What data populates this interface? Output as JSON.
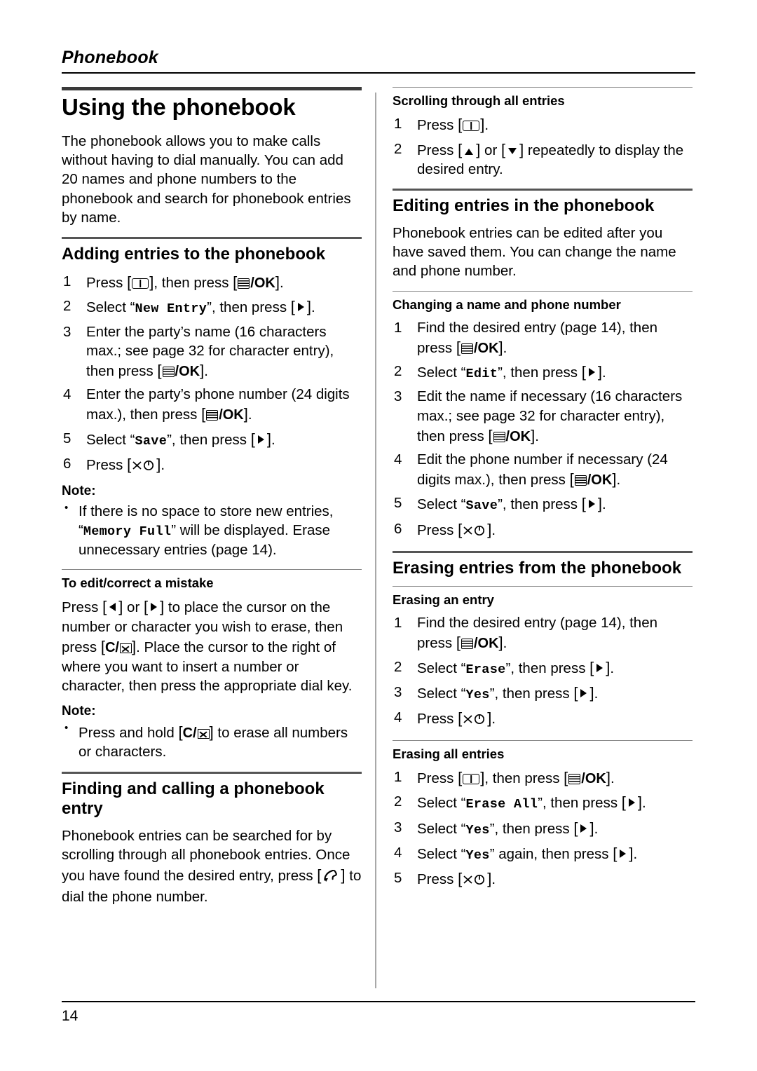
{
  "header": {
    "running_title": "Phonebook"
  },
  "footer": {
    "page_number": "14"
  },
  "left_column": {
    "section_title": "Using the phonebook",
    "intro": "The phonebook allows you to make calls without having to dial manually. You can add 20 names and phone numbers to the phonebook and search for phonebook entries by name.",
    "adding": {
      "title": "Adding entries to the phonebook",
      "steps": [
        "Press [□], then press [≡/OK].",
        "Select “New Entry”, then press [▶].",
        "Enter the party’s name (16 characters max.; see page 32 for character entry), then press [≡/OK].",
        "Enter the party’s phone number (24 digits max.), then press [≡/OK].",
        "Select “Save”, then press [▶].",
        "Press [off]."
      ],
      "note_label": "Note:",
      "note": "If there is no space to store new entries, “Memory Full” will be displayed. Erase unnecessary entries (page 14)."
    },
    "edit_correct": {
      "title": "To edit/correct a mistake",
      "body": "Press [◀] or [▶] to place the cursor on the number or character you wish to erase, then press [C/⌧]. Place the cursor to the right of where you want to insert a number or character, then press the appropriate dial key.",
      "note_label": "Note:",
      "note": "Press and hold [C/⌧] to erase all numbers or characters."
    },
    "finding": {
      "title": "Finding and calling a phonebook entry",
      "body": "Phonebook entries can be searched for by scrolling through all phonebook entries. Once you have found the desired entry, press [talk] to dial the phone number."
    }
  },
  "right_column": {
    "scrolling": {
      "title": "Scrolling through all entries",
      "steps": [
        "Press [□].",
        "Press [▲] or [▼] repeatedly to display the desired entry."
      ]
    },
    "editing": {
      "title": "Editing entries in the phonebook",
      "body": "Phonebook entries can be edited after you have saved them. You can change the name and phone number."
    },
    "changing": {
      "title": "Changing a name and phone number",
      "steps": [
        "Find the desired entry (page 14), then press [≡/OK].",
        "Select “Edit”, then press [▶].",
        "Edit the name if necessary (16 characters max.; see page 32 for character entry), then press [≡/OK].",
        "Edit the phone number if necessary (24 digits max.), then press [≡/OK].",
        "Select “Save”, then press [▶].",
        "Press [off]."
      ]
    },
    "erasing": {
      "title": "Erasing entries from the phonebook",
      "entry": {
        "title": "Erasing an entry",
        "steps": [
          "Find the desired entry (page 14), then press [≡/OK].",
          "Select “Erase”, then press [▶].",
          "Select “Yes”, then press [▶].",
          "Press [off]."
        ]
      },
      "all": {
        "title": "Erasing all entries",
        "steps": [
          "Press [□], then press [≡/OK].",
          "Select “Erase All”, then press [▶].",
          "Select “Yes”, then press [▶].",
          "Select “Yes” again, then press [▶].",
          "Press [off]."
        ]
      }
    }
  },
  "labels": {
    "ok": "/OK",
    "c_clear": "C/",
    "menu_entry": "New Entry",
    "memory_full": "Memory Full",
    "save": "Save",
    "edit": "Edit",
    "erase": "Erase",
    "erase_all": "Erase All",
    "yes": "Yes",
    "then_press": ", then press",
    "select": "Select",
    "press": "Press",
    "word_or": "or"
  }
}
